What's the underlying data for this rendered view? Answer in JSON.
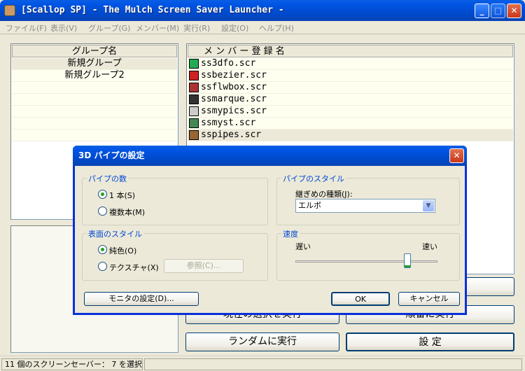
{
  "window": {
    "title": "[Scallop SP] - The Mulch Screen Saver Launcher -",
    "min_label": "_",
    "max_label": "□",
    "close_label": "✕"
  },
  "menu": [
    "ファイル(F)",
    "表示(V)",
    "グループ(G)",
    "メンバー(M)",
    "実行(R)",
    "設定(O)",
    "ヘルプ(H)"
  ],
  "groups": {
    "header": "グループ名",
    "items": [
      "新規グループ",
      "新規グループ2"
    ]
  },
  "members": {
    "header": "メ ン バ ー 登 録 名",
    "items": [
      "ss3dfo.scr",
      "ssbezier.scr",
      "ssflwbox.scr",
      "ssmarque.scr",
      "ssmypics.scr",
      "ssmyst.scr",
      "sspipes.scr"
    ]
  },
  "buttons": {
    "run_selection": "現在の選択を実行",
    "run_sequential": "順番に実行",
    "run_random": "ランダムに実行",
    "settings": "設 定"
  },
  "status": {
    "count": "11 個のスクリーンセーバー：  7 を選択"
  },
  "dialog": {
    "title": "3D パイプの設定",
    "close_label": "✕",
    "pipe_count": {
      "title": "パイプの数",
      "single": "1 本(S)",
      "multiple": "複数本(M)",
      "selected": "single"
    },
    "pipe_style": {
      "title": "パイプのスタイル",
      "joint_label": "継ぎめの種類(J):",
      "joint_value": "エルボ"
    },
    "surface_style": {
      "title": "表面のスタイル",
      "solid": "純色(O)",
      "texture": "テクスチャ(X)",
      "browse": "参照(C)...",
      "selected": "solid"
    },
    "speed": {
      "title": "速度",
      "slow": "遅い",
      "fast": "速い",
      "level": 0.8
    },
    "monitor_button": "モニタの設定(D)...",
    "ok": "OK",
    "cancel": "キャンセル"
  }
}
